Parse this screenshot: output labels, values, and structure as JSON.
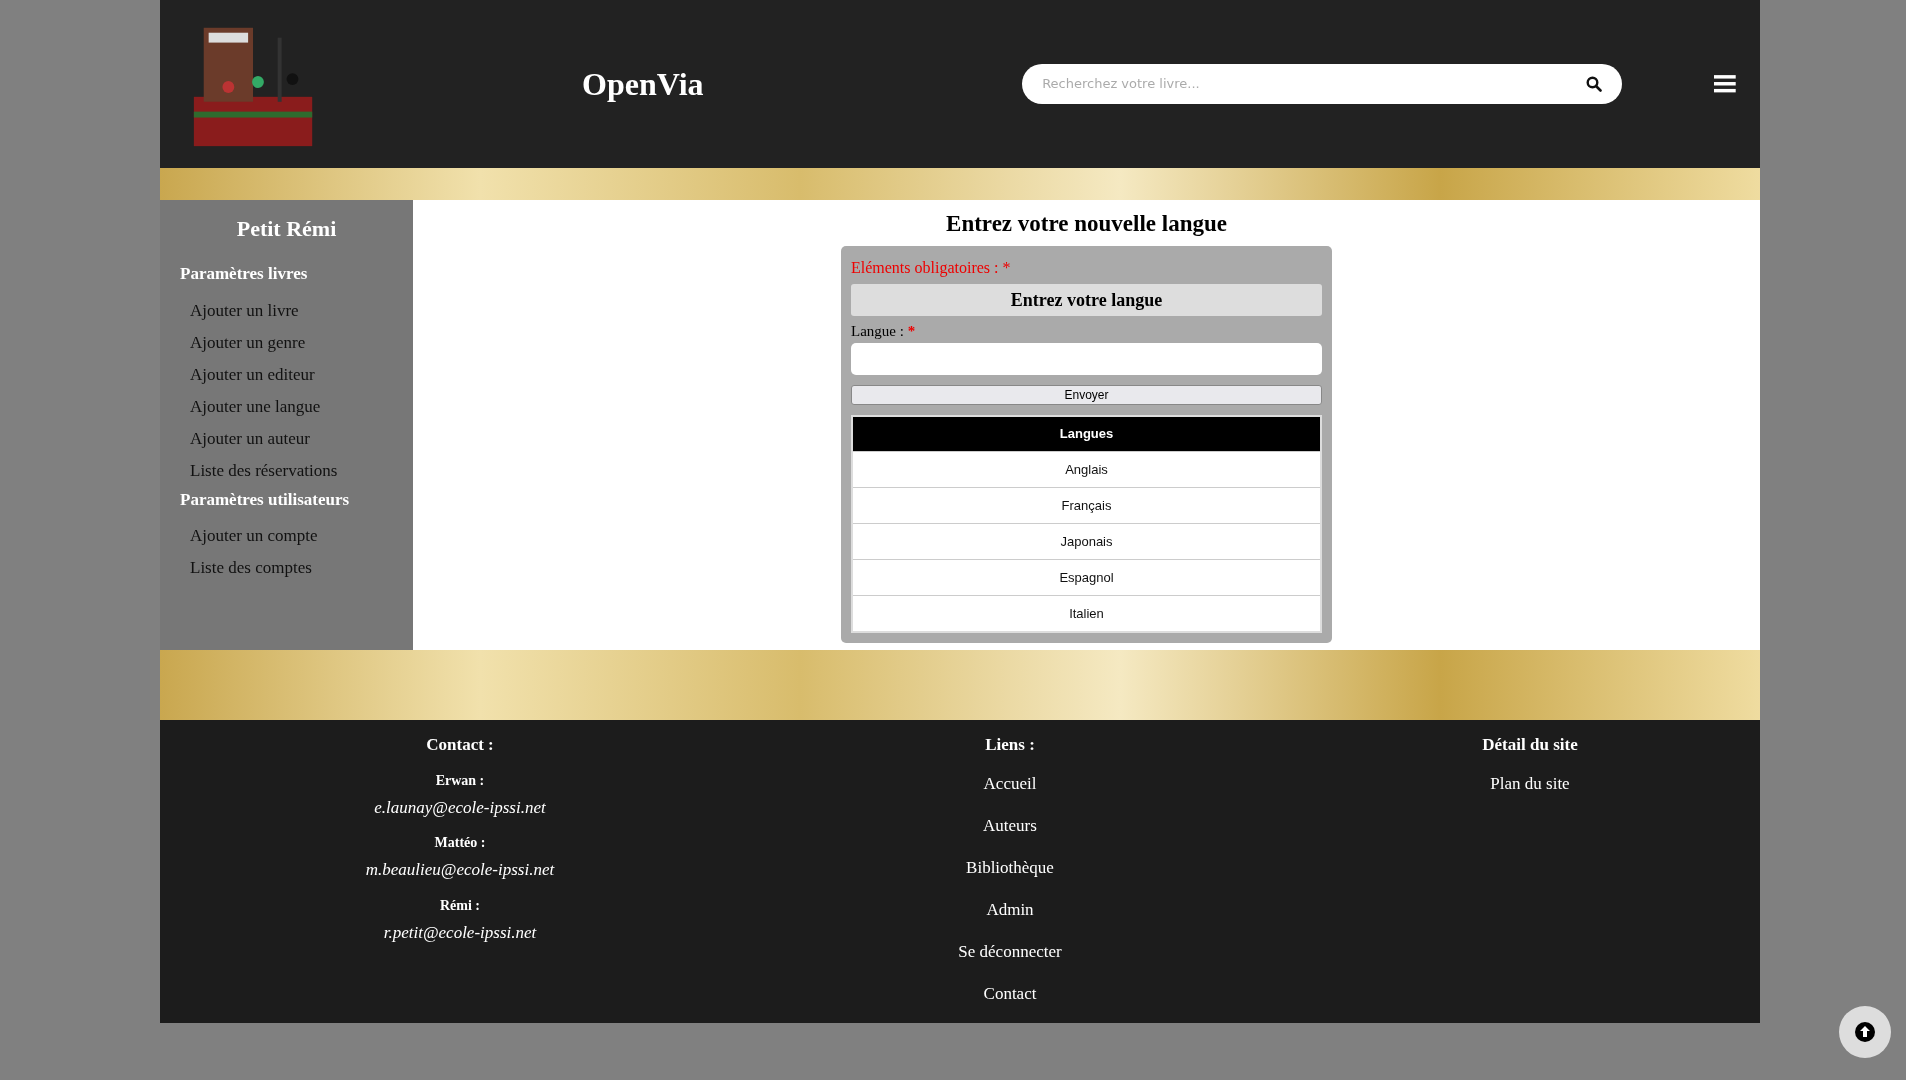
{
  "header": {
    "brand": "OpenVia",
    "search": {
      "placeholder": "Recherchez votre livre..."
    }
  },
  "sidebar": {
    "user": "Petit Rémi",
    "sections": [
      {
        "title": "Paramètres livres",
        "items": [
          "Ajouter un livre",
          "Ajouter un genre",
          "Ajouter un editeur",
          "Ajouter une langue",
          "Ajouter un auteur",
          "Liste des réservations"
        ]
      },
      {
        "title": "Paramètres utilisateurs",
        "items": [
          "Ajouter un compte",
          "Liste des comptes"
        ]
      }
    ]
  },
  "main": {
    "title": "Entrez votre nouvelle langue",
    "required_note": "Eléments obligatoires :",
    "required_mark": "*",
    "form_title": "Entrez votre langue",
    "field": {
      "label": "Langue :",
      "required_mark": "*"
    },
    "submit": "Envoyer",
    "table": {
      "column": "Langues",
      "rows": [
        "Anglais",
        "Français",
        "Japonais",
        "Espagnol",
        "Italien"
      ]
    }
  },
  "footer": {
    "contact": {
      "title": "Contact :",
      "people": [
        {
          "name": "Erwan :",
          "email": "e.launay@ecole-ipssi.net"
        },
        {
          "name": "Mattéo :",
          "email": "m.beaulieu@ecole-ipssi.net"
        },
        {
          "name": "Rémi :",
          "email": "r.petit@ecole-ipssi.net"
        }
      ]
    },
    "links": {
      "title": "Liens :",
      "items": [
        "Accueil",
        "Auteurs",
        "Bibliothèque",
        "Admin",
        "Se déconnecter",
        "Contact"
      ]
    },
    "site": {
      "title": "Détail du site",
      "items": [
        "Plan du site"
      ]
    }
  }
}
